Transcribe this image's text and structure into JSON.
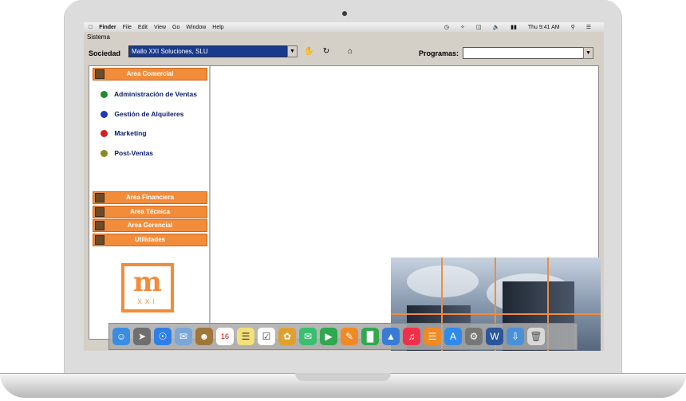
{
  "menubar": {
    "items": [
      "Finder",
      "File",
      "Edit",
      "View",
      "Go",
      "Window",
      "Help"
    ],
    "clock": "Thu 9:41 AM"
  },
  "app": {
    "system_menu": "Sistema",
    "sociedad_label": "Sociedad",
    "sociedad_value": "Mallo XXI Soluciones, SLU",
    "programas_label": "Programas:",
    "programas_value": ""
  },
  "sidebar": {
    "areas": [
      {
        "label": "Area Comercial"
      },
      {
        "label": "Area Financiera"
      },
      {
        "label": "Area Técnica"
      },
      {
        "label": "Area Gerencial"
      },
      {
        "label": "Utilidades"
      }
    ],
    "subitems": [
      {
        "label": "Administración de Ventas",
        "color": "#1f8a2a"
      },
      {
        "label": "Gestión de Alquileres",
        "color": "#1f3bb0"
      },
      {
        "label": "Marketing",
        "color": "#d21f1f"
      },
      {
        "label": "Post-Ventas",
        "color": "#8a8a1f"
      }
    ]
  },
  "colors": {
    "accent": "#f28c3a",
    "selection": "#1a3b8c"
  },
  "logo": {
    "letter": "m",
    "subtitle": "XXI"
  },
  "dock": {
    "icons": [
      "finder-icon",
      "launchpad-icon",
      "safari-icon",
      "mail-icon",
      "contacts-icon",
      "calendar-icon",
      "notes-icon",
      "reminders-icon",
      "photos-icon",
      "messages-icon",
      "facetime-icon",
      "pages-icon",
      "numbers-icon",
      "keynote-icon",
      "music-icon",
      "books-icon",
      "appstore-icon",
      "settings-icon",
      "word-icon",
      "downloads-icon",
      "trash-icon"
    ],
    "calendar_day": "16"
  }
}
